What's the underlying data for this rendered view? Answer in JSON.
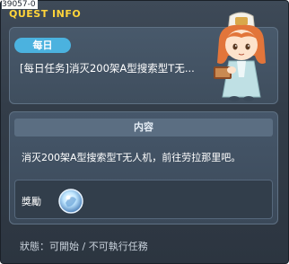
{
  "quest_id": "39057-0",
  "window": {
    "title": "QUEST INFO"
  },
  "quest": {
    "category": "每日",
    "name": "[每日任务]消灭200架A型搜索型T无..."
  },
  "content": {
    "header": "内容",
    "description": "消灭200架A型搜索型T无人机，前往劳拉那里吧。"
  },
  "reward": {
    "label": "獎勵",
    "icon": "exp-orb-icon"
  },
  "status": "狀態：可開始 / 不可執行任務",
  "colors": {
    "title": "#ffd43a",
    "badge": "#4bb2df",
    "panel": "#46576a",
    "background": "#333d49"
  }
}
